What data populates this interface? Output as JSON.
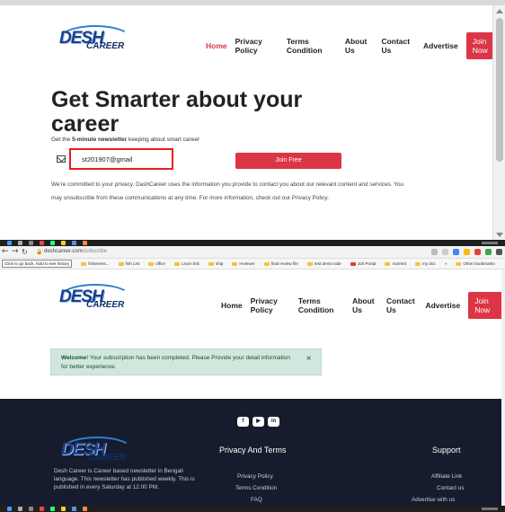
{
  "brand": {
    "logo_word_1": "DESH",
    "logo_word_2": "CAREER"
  },
  "nav": {
    "home": "Home",
    "privacy": "Privacy Policy",
    "terms": "Terms Condition",
    "about": "About Us",
    "contact": "Contact Us",
    "advertise": "Advertise",
    "join": "Join Now"
  },
  "hero": {
    "title": "Get Smarter about your career",
    "sub_prefix": "Get the ",
    "sub_bold": "5-minute newsletter",
    "sub_suffix": " keeping about smart career"
  },
  "subscribe": {
    "email_value": "st201907@gmail",
    "button": "Join Free",
    "privacy_note": "We're committed to your privacy. DashCareer uses the information you provide to contact you about our relevant content and services. You may unsubscribe from these communications at any time. For more information, check out our Privacy Policy."
  },
  "browser": {
    "url_host": "deshcareer.com",
    "url_path": "/subscribe",
    "tooltip": "Click to go back, hold to see history",
    "bookmarks": [
      "finiteness...",
      "fish List",
      "office",
      "Learn link",
      "ship",
      "reviewer",
      "final review file",
      "test demo side",
      "Job Portal",
      "married",
      "my doc",
      "Other bookmarks"
    ],
    "more": "»"
  },
  "welcome": {
    "bold": "Welcome",
    "message": "! Your subscription has been completed. Please Provide your detail information for better experience.",
    "close": "×"
  },
  "footer": {
    "social": [
      "f",
      "▶",
      "in"
    ],
    "about": "Desh Career is Career based newsletter in Bengali language. This newsletter has published weekly. This is published in every Saturday at 12.00 PM.",
    "privacy_heading": "Privacy And Terms",
    "privacy_links": [
      "Privacy Policy",
      "Terms Condition",
      "FAQ"
    ],
    "support_heading": "Support",
    "support_links": [
      "Affiliate Link",
      "Contact us",
      "Advertise with us"
    ]
  },
  "colors": {
    "accent": "#dc3545",
    "footer_bg": "#161c2d",
    "success_bg": "#d1e7dd"
  }
}
